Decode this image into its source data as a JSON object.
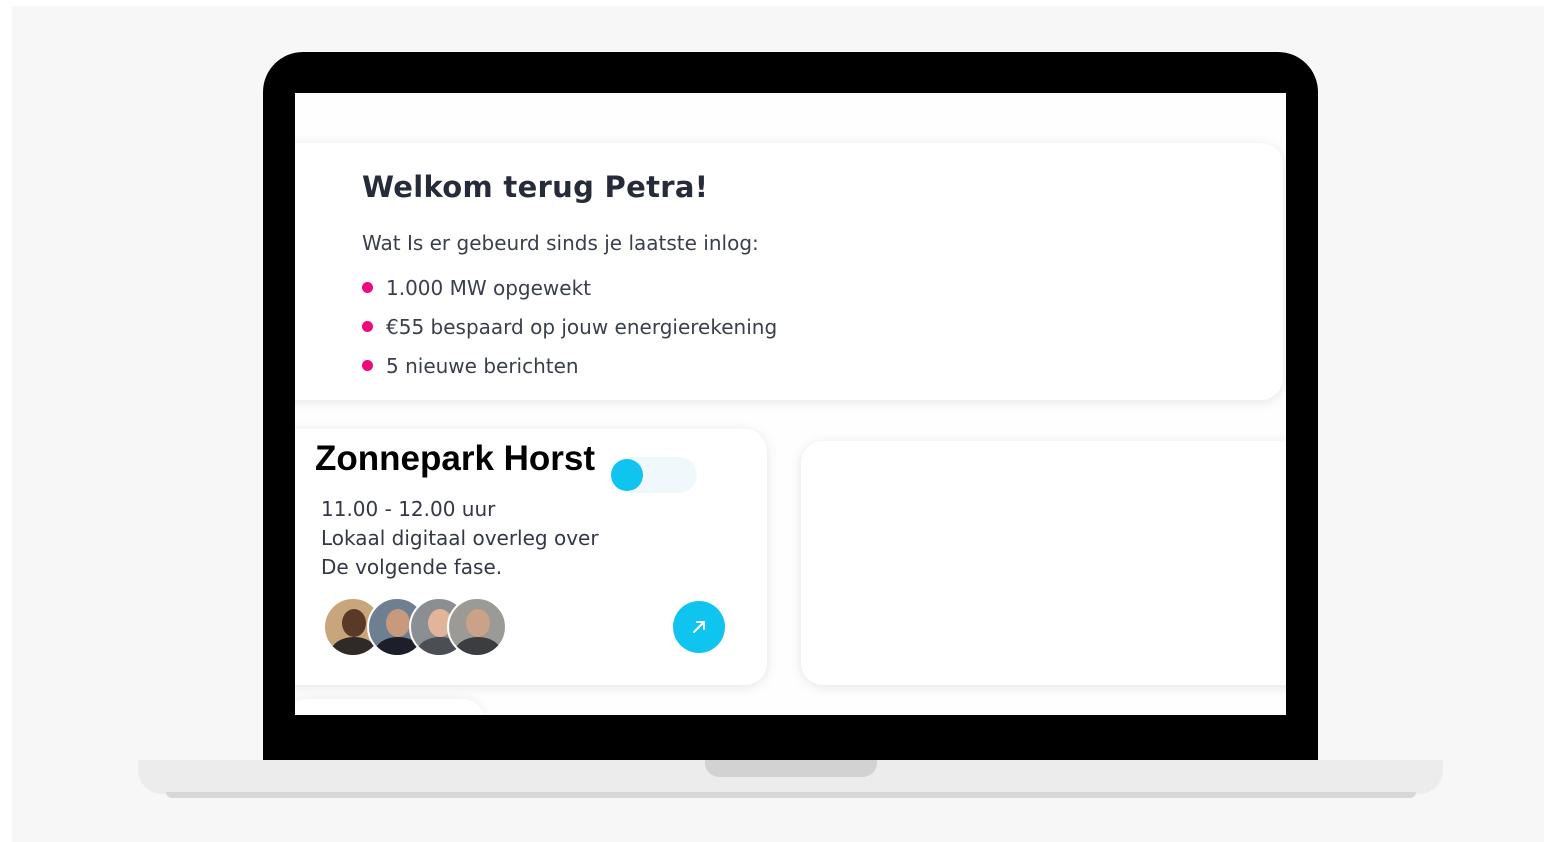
{
  "welcome": {
    "title": "Welkom terug Petra!",
    "subtitle": "Wat Is er gebeurd sinds je laatste inlog:",
    "bullet_color": "#f0087d",
    "items": [
      "1.000 MW opgewekt",
      "€55 bespaard op jouw energierekening",
      "5 nieuwe berichten"
    ]
  },
  "event": {
    "title": "Zonnepark Horst",
    "time": "11.00 - 12.00 uur",
    "description_line1": "Lokaal digitaal overleg over",
    "description_line2": "De volgende fase.",
    "toggle_icon": "toggle-switch",
    "open_icon": "arrow-up-right-icon",
    "accent": "#0fc4ef",
    "participants": [
      {
        "icon": "avatar"
      },
      {
        "icon": "avatar"
      },
      {
        "icon": "avatar"
      },
      {
        "icon": "avatar"
      }
    ]
  },
  "colors": {
    "background": "#f7f7f7",
    "laptop_frame": "#000000",
    "card": "#ffffff",
    "text_dark": "#262b39"
  }
}
